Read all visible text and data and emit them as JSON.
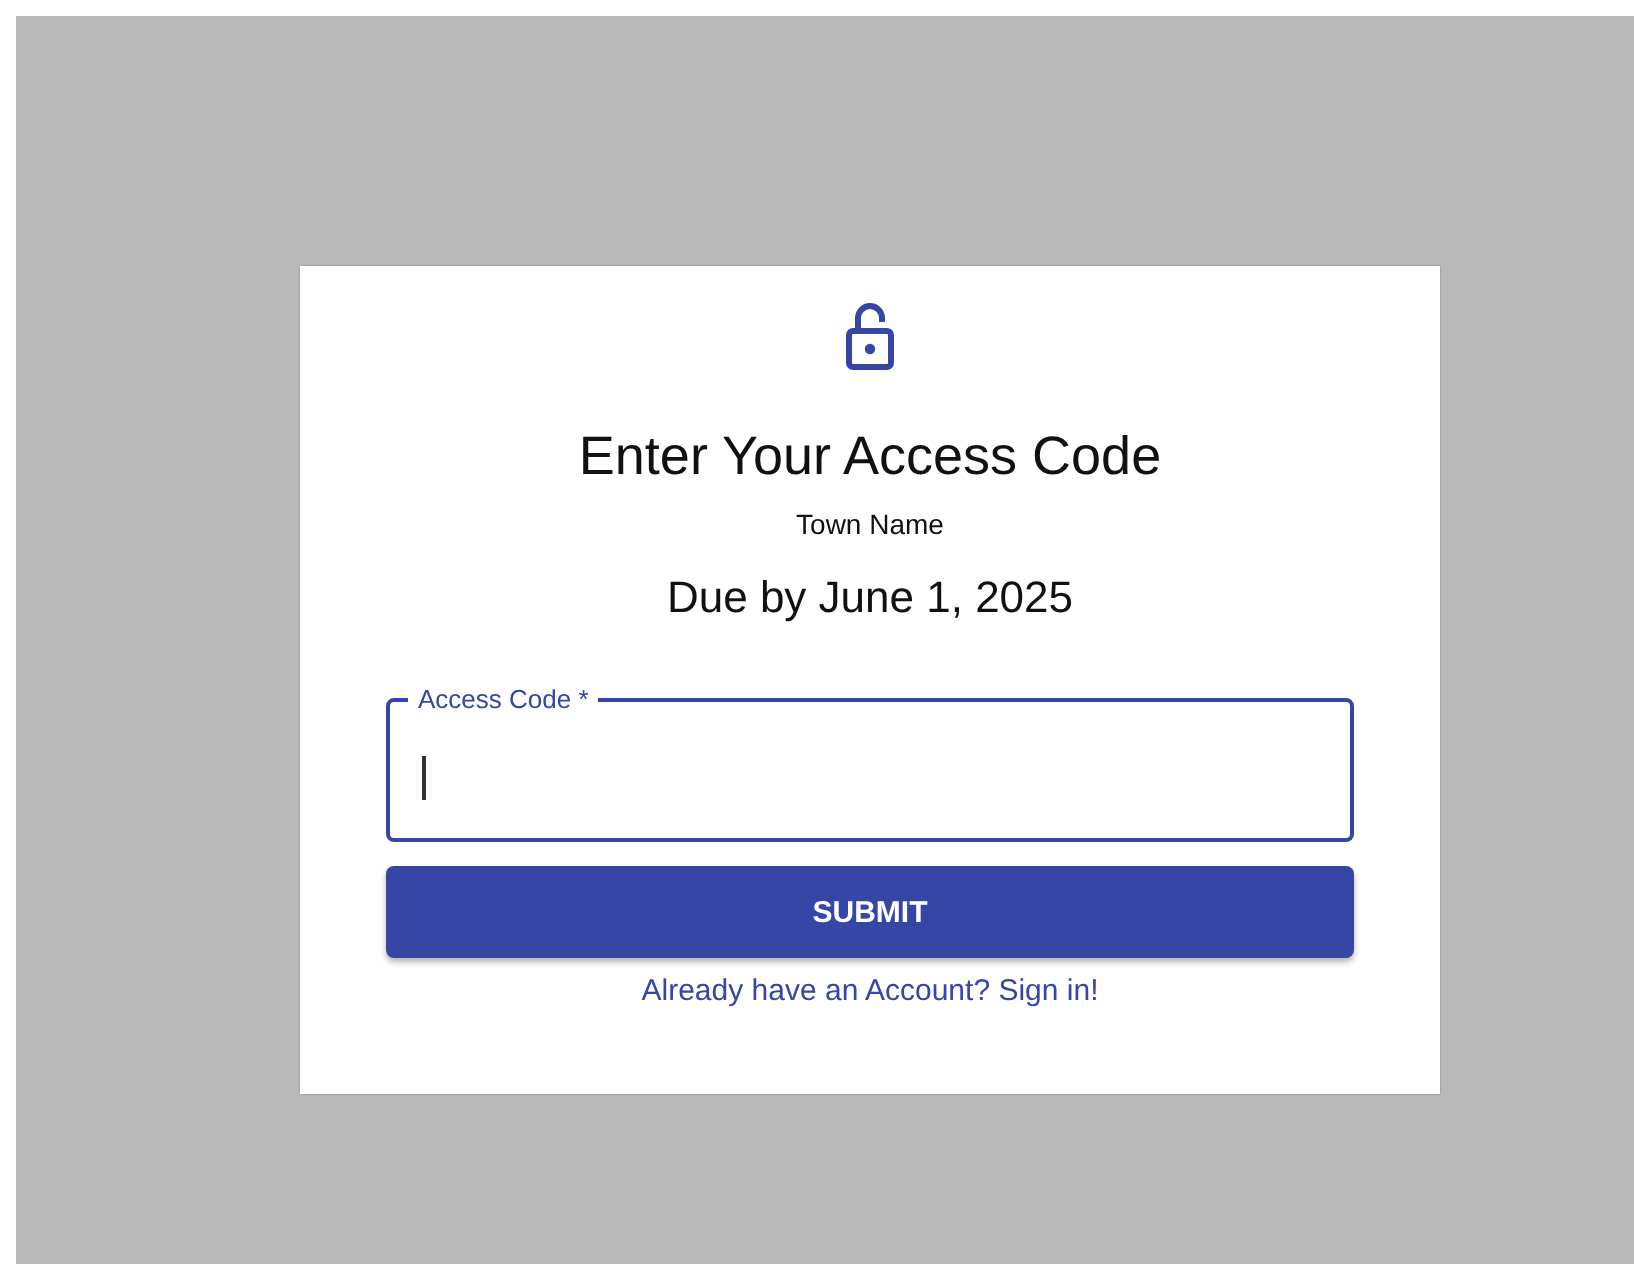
{
  "title": "Enter Your Access Code",
  "town": "Town Name",
  "due": "Due by June 1, 2025",
  "access_code_field": {
    "label": "Access Code *",
    "focused": true
  },
  "submit_button": "SUBMIT",
  "sign_in_link": "Already have an Account? Sign in!"
}
